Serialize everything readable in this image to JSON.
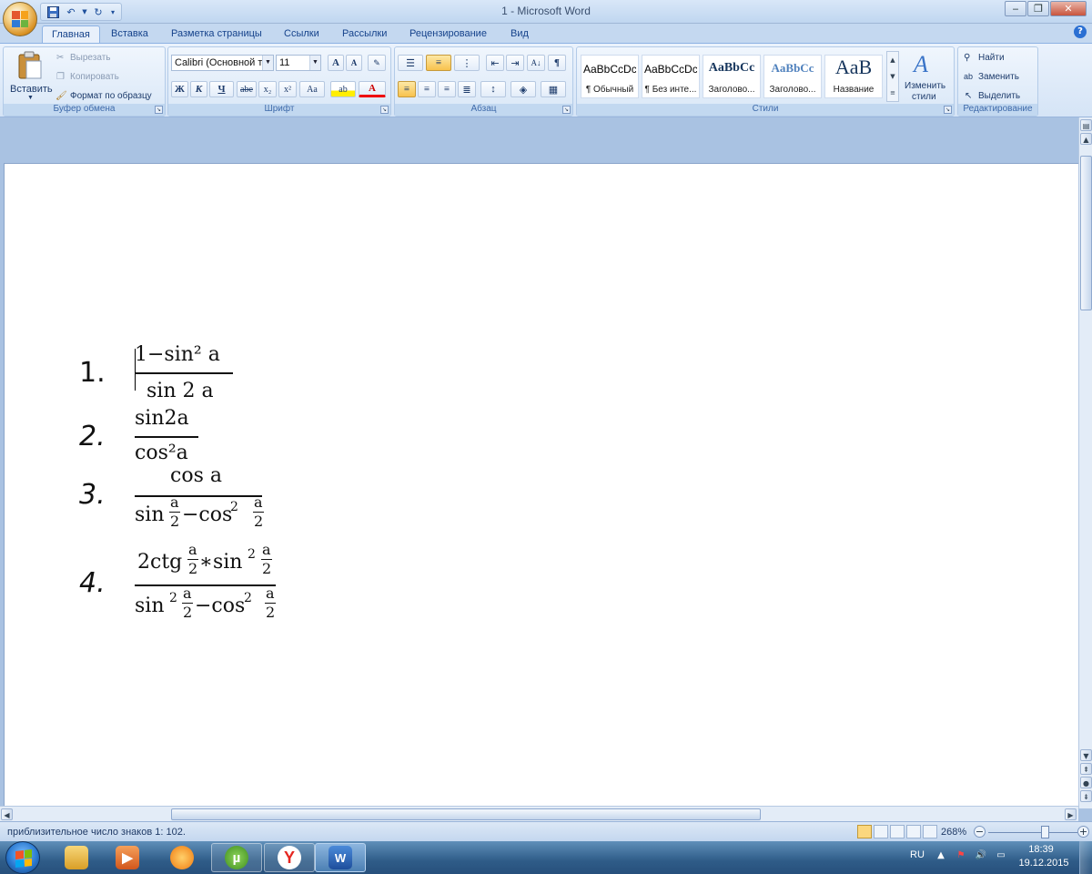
{
  "window": {
    "title": "1 - Microsoft Word",
    "minimize": "‒",
    "restore": "❐",
    "close": "✕"
  },
  "quick_access": {
    "save_icon": "save-icon",
    "undo_icon": "undo-icon",
    "redo_icon": "redo-icon"
  },
  "tabs": [
    "Главная",
    "Вставка",
    "Разметка страницы",
    "Ссылки",
    "Рассылки",
    "Рецензирование",
    "Вид"
  ],
  "active_tab": "Главная",
  "clipboard": {
    "label": "Буфер обмена",
    "paste": "Вставить",
    "cut": "Вырезать",
    "copy": "Копировать",
    "format_painter": "Формат по образцу"
  },
  "font": {
    "label": "Шрифт",
    "family": "Calibri (Основной те",
    "size": "11",
    "grow": "A",
    "shrink": "A",
    "bold": "Ж",
    "italic": "К",
    "underline": "Ч",
    "strike": "abe",
    "sub": "x₂",
    "sup": "x²",
    "case": "Aa",
    "highlight": "ab",
    "color": "A"
  },
  "paragraph": {
    "label": "Абзац",
    "pilcrow": "¶"
  },
  "styles": {
    "label": "Стили",
    "items": [
      {
        "sample": "AaBbCcDc",
        "caption": "¶ Обычный"
      },
      {
        "sample": "AaBbCcDc",
        "caption": "¶ Без инте..."
      },
      {
        "sample": "AaBbCc",
        "caption": "Заголово..."
      },
      {
        "sample": "AaBbCc",
        "caption": "Заголово..."
      },
      {
        "sample": "AaB",
        "caption": "Название"
      }
    ],
    "change_styles": [
      "Изменить",
      "стили"
    ]
  },
  "editing": {
    "label": "Редактирование",
    "find": "Найти",
    "replace": "Заменить",
    "select": "Выделить"
  },
  "document": {
    "items": [
      {
        "number": "1.",
        "numerator": "1−sin² a",
        "denominator": "sin 2 a"
      },
      {
        "number": "2.",
        "numerator": "sin2a",
        "denominator": "cos²a"
      },
      {
        "number": "3.",
        "numerator": "cos a",
        "denominator": "sin(a/2)−cos²(a/2)"
      },
      {
        "number": "4.",
        "numerator": "2ctg(a/2)∗sin²(a/2)",
        "denominator": "sin²(a/2)−cos²(a/2)"
      }
    ]
  },
  "status": {
    "text": "приблизительное число знаков 1: 102.",
    "zoom": "268%"
  },
  "taskbar": {
    "language": "RU",
    "time": "18:39",
    "date": "19.12.2015",
    "apps": [
      "explorer",
      "media-player",
      "browser",
      "utorrent",
      "yandex",
      "word"
    ]
  },
  "colors": {
    "accent": "#15428b",
    "ribbon_bg": "#d5e4f6",
    "workspace_bg": "#a9c2e2",
    "taskbar": "#2f5c88"
  }
}
